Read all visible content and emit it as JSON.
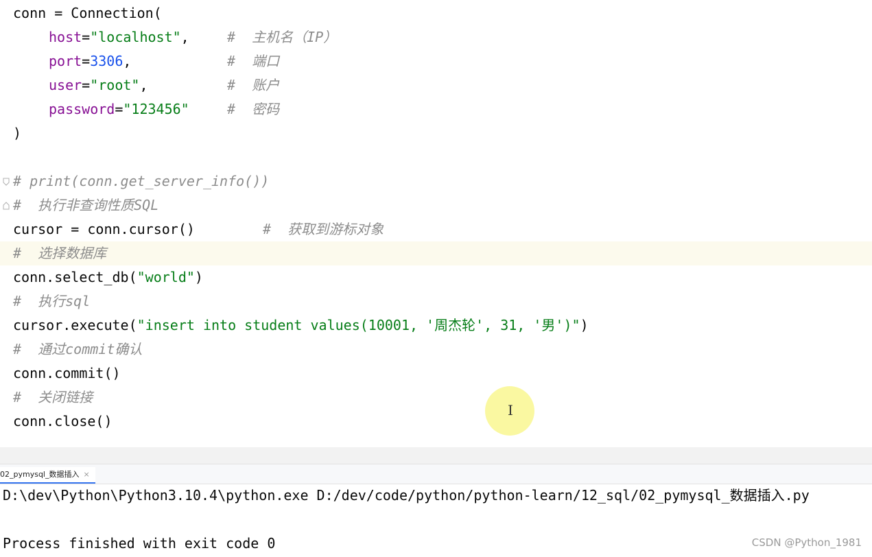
{
  "editor": {
    "l1": "conn = Connection(",
    "l2": {
      "name": "host",
      "eq": "=",
      "value": "\"localhost\"",
      "comma": ",",
      "comment": "#  主机名（IP）"
    },
    "l3": {
      "name": "port",
      "eq": "=",
      "value": "3306",
      "comma": ",",
      "comment": "#  端口"
    },
    "l4": {
      "name": "user",
      "eq": "=",
      "value": "\"root\"",
      "comma": ",",
      "comment": "#  账户"
    },
    "l5": {
      "name": "password",
      "eq": "=",
      "value": "\"123456\"",
      "comment": "#  密码"
    },
    "l6": ")",
    "l8": "# print(conn.get_server_info())",
    "l9": "#  执行非查询性质SQL",
    "l10": {
      "code": "cursor = conn.cursor()",
      "comment": "#  获取到游标对象"
    },
    "l11": "#  选择数据库",
    "l12": {
      "a": "conn.select_db(",
      "s": "\"world\"",
      "b": ")"
    },
    "l13": "#  执行sql",
    "l14": {
      "a": "cursor.execute(",
      "s": "\"insert into student values(10001, '周杰轮', 31, '男')\"",
      "b": ")"
    },
    "l15": "#  通过commit确认",
    "l16": "conn.commit()",
    "l17": "#  关闭链接",
    "l18": "conn.close()"
  },
  "run_tab": {
    "label": "02_pymysql_数据插入",
    "close": "×"
  },
  "console": {
    "command": "D:\\dev\\Python\\Python3.10.4\\python.exe D:/dev/code/python/python-learn/12_sql/02_pymysql_数据插入.py",
    "result": "Process finished with exit code 0"
  },
  "watermark": "CSDN @Python_1981",
  "icons": {
    "fold": "fold-arrow-icon",
    "cursor": "text-cursor-icon"
  }
}
